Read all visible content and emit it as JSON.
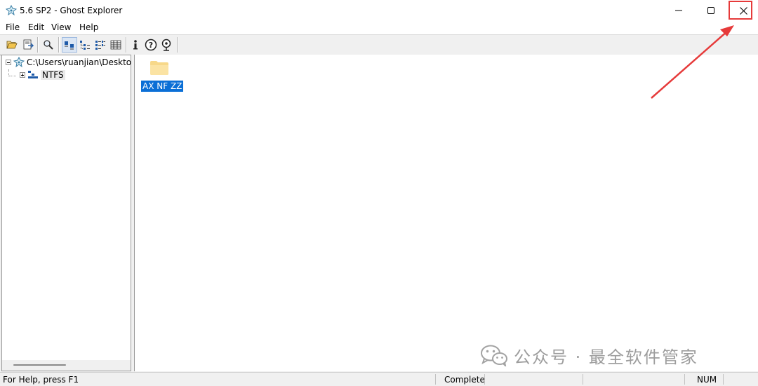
{
  "window": {
    "title": "5.6 SP2 - Ghost Explorer",
    "app_icon": "ghost-explorer-icon",
    "controls": [
      "minimize-icon",
      "maximize-icon",
      "close-icon"
    ],
    "close_highlight_color": "#e63a3a"
  },
  "menu": {
    "items": [
      "File",
      "Edit",
      "View",
      "Help"
    ]
  },
  "toolbar": {
    "buttons": [
      {
        "icon": "open-folder-icon"
      },
      {
        "icon": "extract-icon"
      },
      {
        "icon": "find-icon"
      },
      {
        "icon": "large-icons-view-icon",
        "active": true
      },
      {
        "icon": "tree-view-icon"
      },
      {
        "icon": "list-view-icon"
      },
      {
        "icon": "details-view-icon"
      },
      {
        "icon": "info-icon"
      },
      {
        "icon": "help-icon"
      },
      {
        "icon": "whats-this-icon"
      }
    ]
  },
  "tree": {
    "root": {
      "label": "C:\\Users\\ruanjian\\Desktop",
      "expanded": true
    },
    "children": [
      {
        "label": "NTFS",
        "expanded": false,
        "selected": true
      }
    ]
  },
  "content": {
    "items": [
      {
        "label": "AX NF ZZ",
        "icon": "folder-icon",
        "selected": true
      }
    ]
  },
  "watermark": {
    "text": "公众号 · 最全软件管家",
    "icon": "wechat-icon"
  },
  "status": {
    "help": "For Help, press F1",
    "state": "Complete",
    "num": "NUM"
  },
  "colors": {
    "accent_selection": "#0b6fd6",
    "annotation": "#e63a3a"
  }
}
